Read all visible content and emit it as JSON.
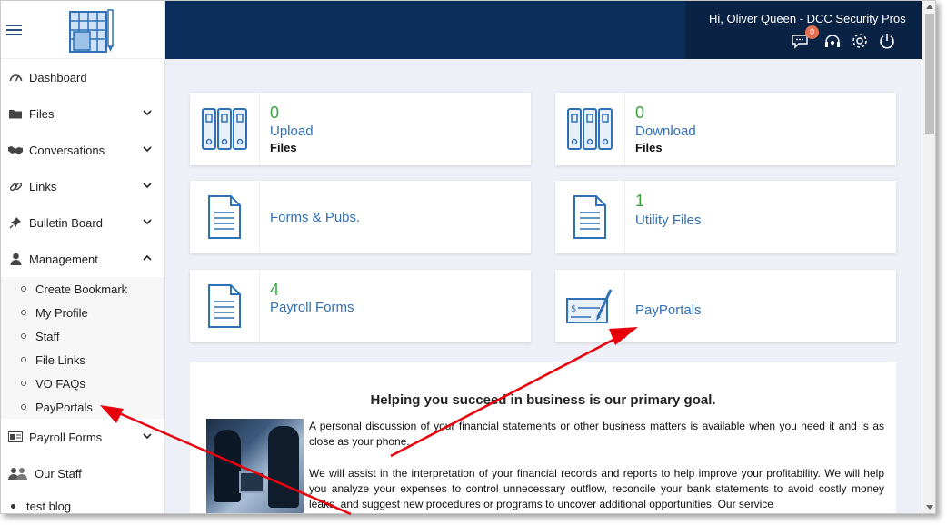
{
  "header": {
    "greeting": "Hi, Oliver Queen - DCC Security Pros",
    "notification_count": "0",
    "icons": [
      "chat-icon",
      "support-icon",
      "gear-icon",
      "power-icon"
    ]
  },
  "sidebar": {
    "items": [
      {
        "label": "Dashboard",
        "icon": "dashboard-icon"
      },
      {
        "label": "Files",
        "icon": "folder-icon",
        "expandable": true
      },
      {
        "label": "Conversations",
        "icon": "handshake-icon",
        "expandable": true
      },
      {
        "label": "Links",
        "icon": "link-icon",
        "expandable": true
      },
      {
        "label": "Bulletin Board",
        "icon": "pin-icon",
        "expandable": true
      },
      {
        "label": "Management",
        "icon": "user-icon",
        "expanded": true
      }
    ],
    "management_sub": [
      "Create Bookmark",
      "My Profile",
      "Staff",
      "File Links",
      "VO FAQs",
      "PayPortals"
    ],
    "bottom_items": [
      {
        "label": "Payroll Forms",
        "icon": "payroll-icon",
        "expandable": true
      },
      {
        "label": "Our Staff",
        "icon": "staff-icon"
      },
      {
        "label": "test blog",
        "icon": "bullet"
      }
    ]
  },
  "cards": {
    "upload": {
      "count": "0",
      "label": "Upload",
      "sub": "Files"
    },
    "download": {
      "count": "0",
      "label": "Download",
      "sub": "Files"
    },
    "forms": {
      "label": "Forms & Pubs."
    },
    "utility": {
      "count": "1",
      "label": "Utility Files"
    },
    "payroll": {
      "count": "4",
      "label": "Payroll Forms"
    },
    "payportals": {
      "label": "PayPortals"
    }
  },
  "article": {
    "title": "Helping you succeed in business is our primary goal.",
    "para1": "A personal discussion of your financial statements or other business matters is available when you need it and is as close as your phone.",
    "para2": "We will assist in the interpretation of your financial records and reports to help improve your profitability. We will help you analyze your expenses to control unnecessary outflow, reconcile your bank statements to avoid costly money leaks, and suggest new procedures or programs to uncover additional opportunities. Our service"
  },
  "colors": {
    "header_bg": "#0c2c5c",
    "accent_blue": "#2f70b6",
    "count_green": "#3aa040",
    "badge": "#e76f51",
    "annotation_arrow": "#e8000d"
  }
}
